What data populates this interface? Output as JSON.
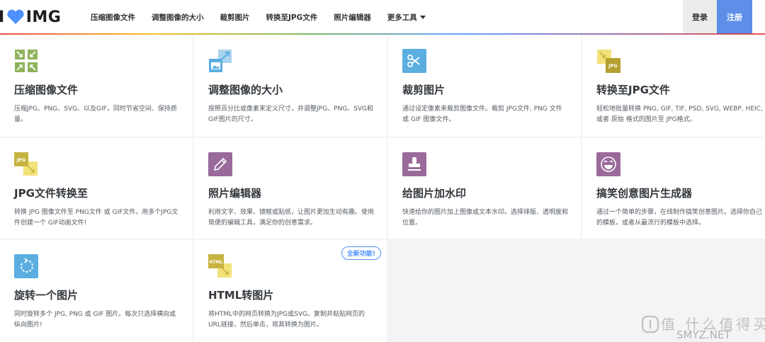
{
  "header": {
    "logo_text": "IMG",
    "nav": [
      "压缩图像文件",
      "调整图像的大小",
      "裁剪图片",
      "转换至JPG文件",
      "照片编辑器",
      "更多工具"
    ],
    "login": "登录",
    "register": "注册"
  },
  "tools": [
    {
      "title": "压缩图像文件",
      "desc": "压缩JPG、PNG、SVG、以及GIF，同时节省空间、保持质量。",
      "icon": "compress-icon"
    },
    {
      "title": "调整图像的大小",
      "desc": "按照百分比或像素来定义尺寸，并调整JPG、PNG、SVG和GIF图片的尺寸。",
      "icon": "resize-icon"
    },
    {
      "title": "裁剪图片",
      "desc": "通过设定像素来裁剪图像文件。裁剪 JPG文件, PNG 文件 或 GIF 图像文件。",
      "icon": "scissors-icon"
    },
    {
      "title": "转换至JPG文件",
      "desc": "轻松地批量转换 PNG, GIF, TIF, PSD, SVG, WEBP, HEIC, 或者 原始 格式的图片至 JPG格式。",
      "icon": "convert-to-jpg-icon"
    },
    {
      "title": "JPG文件转换至",
      "desc": "转换 JPG 图像文件至 PNG文件 或 GIF文件。用多个JPG文件创建一个 GIF动画文件!",
      "icon": "convert-from-jpg-icon"
    },
    {
      "title": "照片编辑器",
      "desc": "利用文字、效果、镜框或贴纸，让图片更加生动有趣。使用简便的编辑工具，满足你的创意需求。",
      "icon": "pencil-icon"
    },
    {
      "title": "给图片加水印",
      "desc": "快速给你的图片加上图像或文本水印。选择排版、透明度和位置。",
      "icon": "stamp-icon"
    },
    {
      "title": "搞笑创意图片生成器",
      "desc": "通过一个简单的步骤，在线制作搞笑创意图片。选择你自己的模板，或者从最流行的模板中选择。",
      "icon": "laugh-face-icon"
    },
    {
      "title": "旋转一个图片",
      "desc": "同时旋转多个 JPG, PNG 或 GIF 图片。每次只选择横向或纵向图片!",
      "icon": "rotate-icon"
    },
    {
      "title": "HTML转图片",
      "desc": "将HTML中的网页转换为JPG或SVG。复制并粘贴网页的URL链接，然后单击，将其转换为图片。",
      "icon": "html-icon",
      "badge": "全新功能!"
    }
  ],
  "watermark": {
    "cn": "值 什么值得买",
    "en": "SMYZ.NET"
  },
  "colors": {
    "green": "#8fb35a",
    "blue": "#5aaee0",
    "gold": "#c7b340",
    "purple": "#9a6a9a",
    "register": "#5d8ee8"
  }
}
